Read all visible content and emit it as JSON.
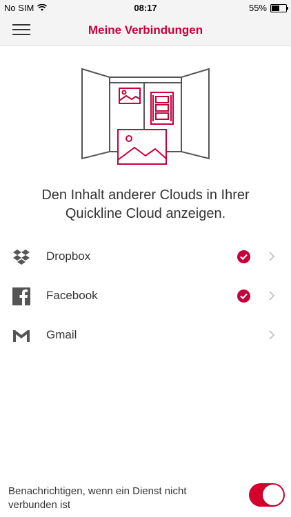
{
  "status_bar": {
    "carrier": "No SIM",
    "time": "08:17",
    "battery": "55%"
  },
  "nav": {
    "title": "Meine Verbindungen"
  },
  "headline": "Den Inhalt anderer Clouds in Ihrer Quickline Cloud anzeigen.",
  "services": [
    {
      "label": "Dropbox",
      "icon": "dropbox-icon",
      "connected": true
    },
    {
      "label": "Facebook",
      "icon": "facebook-icon",
      "connected": true
    },
    {
      "label": "Gmail",
      "icon": "gmail-icon",
      "connected": false
    }
  ],
  "notification": {
    "label": "Benachrichtigen, wenn ein Dienst nicht verbunden ist",
    "enabled": true
  },
  "colors": {
    "accent": "#c7003a",
    "toggle_on": "#d4002e"
  }
}
